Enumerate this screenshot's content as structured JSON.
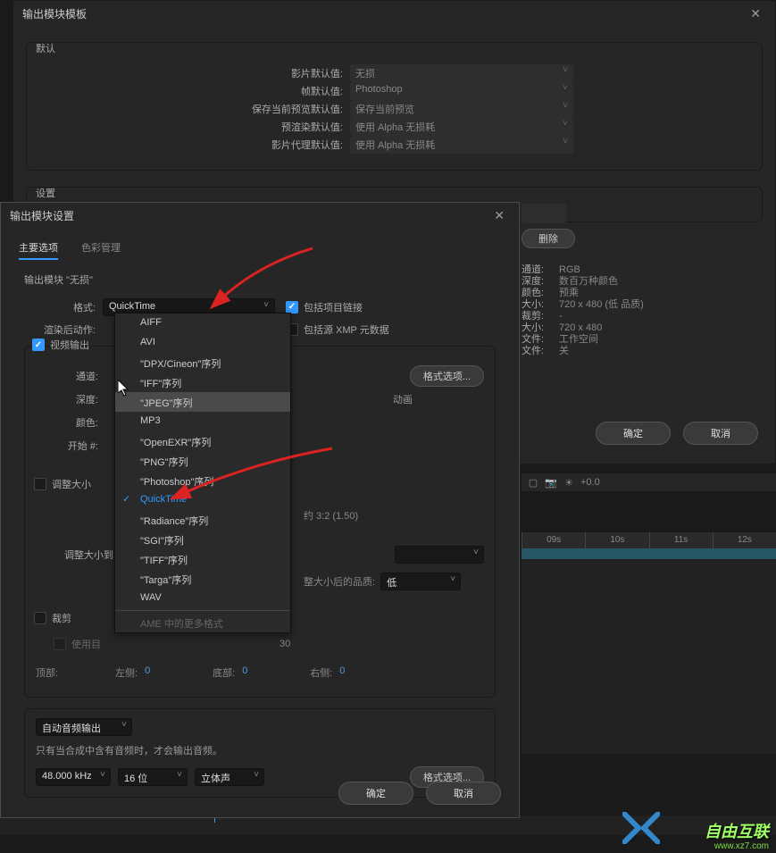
{
  "dialog1": {
    "title": "输出模块模板",
    "defaults": {
      "panelLabel": "默认",
      "rows": [
        {
          "label": "影片默认值:",
          "value": "无损"
        },
        {
          "label": "帧默认值:",
          "value": "Photoshop"
        },
        {
          "label": "保存当前预览默认值:",
          "value": "保存当前预览"
        },
        {
          "label": "预渲染默认值:",
          "value": "使用 Alpha 无损耗"
        },
        {
          "label": "影片代理默认值:",
          "value": "使用 Alpha 无损耗"
        }
      ]
    },
    "settings": {
      "panelLabel": "设置"
    },
    "deleteBtn": "删除",
    "ok": "确定",
    "cancel": "取消"
  },
  "dialog2": {
    "title": "输出模块设置",
    "tabs": {
      "main": "主要选项",
      "color": "色彩管理"
    },
    "moduleName": "输出模块 \"无损\"",
    "format": {
      "label": "格式:",
      "value": "QuickTime"
    },
    "postRender": {
      "label": "渲染后动作:"
    },
    "includeLink": "包括项目链接",
    "includeXmp": "包括源 XMP 元数据",
    "videoOutput": "视频输出",
    "channel": "通道:",
    "depth": "深度:",
    "color": "颜色:",
    "startNum": "开始 #:",
    "formatOptions": "格式选项...",
    "anim": "动画",
    "resize": "调整大小",
    "resizeTo": "调整大小到:",
    "lockAspect": "约 3:2 (1.50)",
    "resizeQuality": "整大小后的品质:",
    "qualityLow": "低",
    "crop": "裁剪",
    "useRoi": "使用目",
    "finalSize": "30",
    "top": "顶部:",
    "left": "左侧:",
    "bottom": "底部:",
    "right": "右侧:",
    "zero": "0",
    "audioAuto": "自动音频输出",
    "audioNote": "只有当合成中含有音频时，才会输出音频。",
    "sampleRate": "48.000 kHz",
    "bitDepth": "16 位",
    "channels": "立体声",
    "ok": "确定",
    "cancel": "取消"
  },
  "dropdown": {
    "items": [
      "AIFF",
      "AVI",
      "\"DPX/Cineon\"序列",
      "\"IFF\"序列",
      "\"JPEG\"序列",
      "MP3",
      "\"OpenEXR\"序列",
      "\"PNG\"序列",
      "\"Photoshop\"序列",
      "QuickTime",
      "\"Radiance\"序列",
      "\"SGI\"序列",
      "\"TIFF\"序列",
      "\"Targa\"序列",
      "WAV"
    ],
    "moreFormats": "AME 中的更多格式"
  },
  "info": {
    "channel": {
      "k": "通道:",
      "v": "RGB"
    },
    "depth": {
      "k": "深度:",
      "v": "数百万种颜色"
    },
    "color": {
      "k": "颜色:",
      "v": "预乘"
    },
    "size": {
      "k": "大小:",
      "v": "720 x 480 (低 品质)"
    },
    "crop": {
      "k": "裁剪:",
      "v": "-"
    },
    "finalSize": {
      "k": "大小:",
      "v": "720 x 480"
    },
    "profile": {
      "k": "文件:",
      "v": "工作空间"
    },
    "outFile": {
      "k": "文件:",
      "v": "关"
    }
  },
  "timeline": {
    "exposure": "+0.0",
    "ticks": [
      "09s",
      "10s",
      "11s",
      "12s"
    ]
  },
  "watermark": {
    "text": "自由互联",
    "url": "www.xz7.com"
  }
}
